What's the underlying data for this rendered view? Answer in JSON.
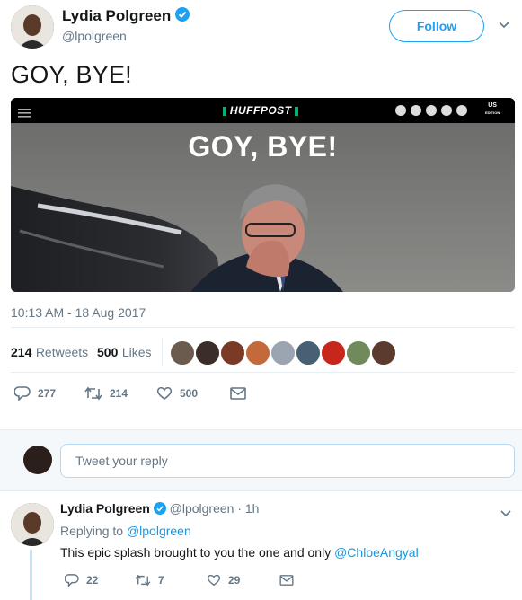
{
  "author": {
    "name": "Lydia Polgreen",
    "handle": "@lpolgreen",
    "follow_label": "Follow"
  },
  "tweet": {
    "text": "GOY, BYE!",
    "timestamp": "10:13 AM - 18 Aug 2017"
  },
  "media": {
    "brand": "HUFFPOST",
    "headline": "GOY, BYE!",
    "edition_top": "US",
    "edition_bottom": "EDITION"
  },
  "stats": {
    "retweets_count": "214",
    "retweets_label": "Retweets",
    "likes_count": "500",
    "likes_label": "Likes"
  },
  "actions": {
    "replies": "277",
    "retweets": "214",
    "likes": "500"
  },
  "reply_box": {
    "placeholder": "Tweet your reply"
  },
  "reply": {
    "name": "Lydia Polgreen",
    "handle": "@lpolgreen",
    "sep": "·",
    "time": "1h",
    "replying_prefix": "Replying to",
    "replying_handle": "@lpolgreen",
    "text": "This epic splash brought to you the one and only",
    "mention": "@ChloeAngyal",
    "counts": {
      "replies": "22",
      "retweets": "7",
      "likes": "29"
    }
  },
  "colors": {
    "accent": "#1da1f2",
    "verified": "#1da1f2",
    "huffpost_green": "#00b17b"
  }
}
